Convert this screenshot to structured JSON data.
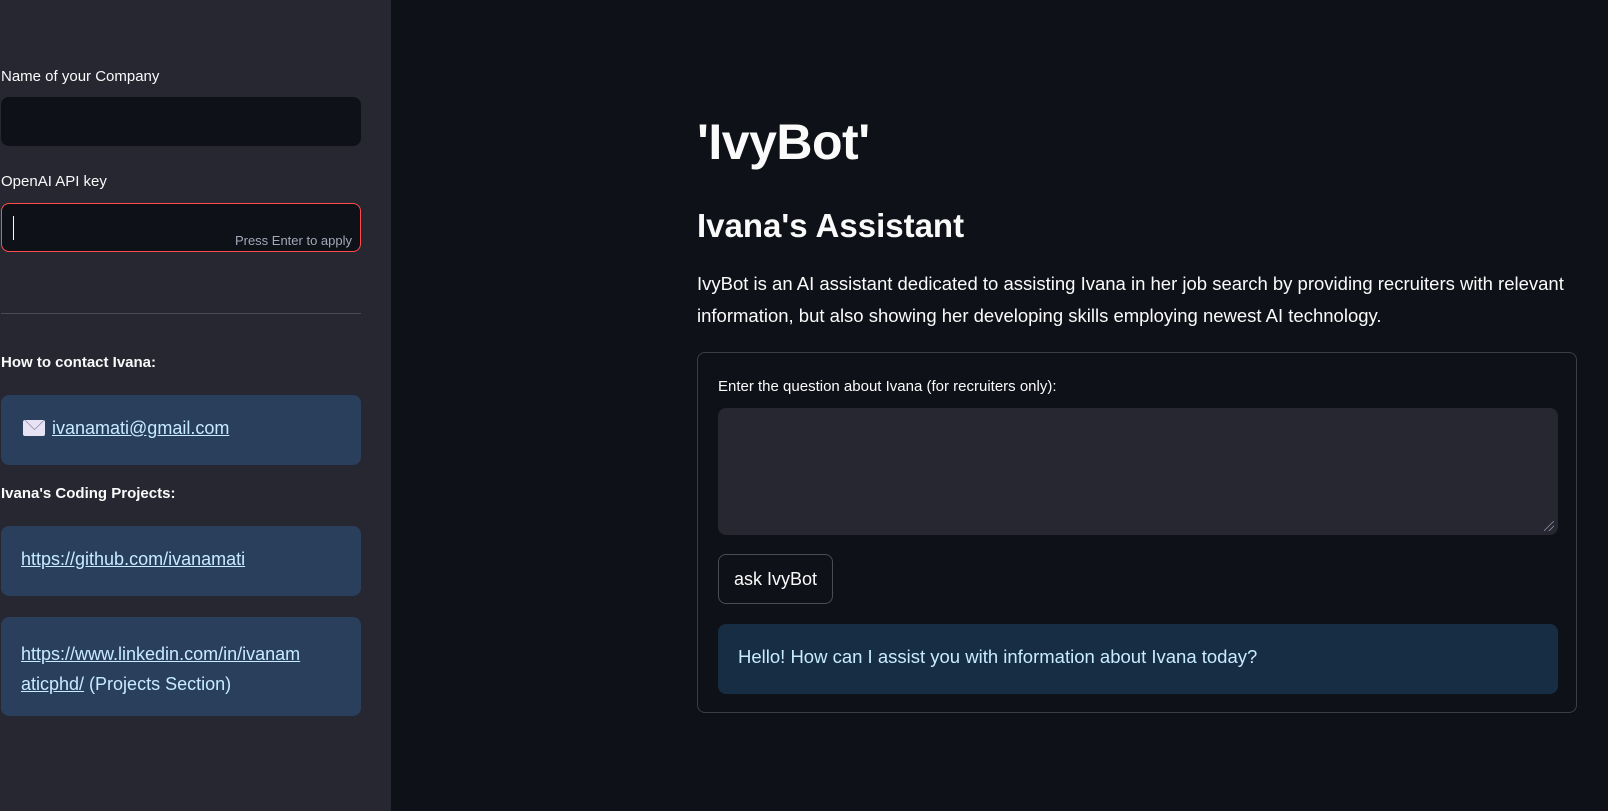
{
  "sidebar": {
    "company_label": "Name of your Company",
    "company_value": "",
    "api_key_label": "OpenAI API key",
    "api_key_value": "",
    "api_key_hint": "Press Enter to apply",
    "contact_heading": "How to contact Ivana:",
    "email": "ivanamati@gmail.com",
    "projects_heading": "Ivana's Coding Projects:",
    "github_link": "https://github.com/ivanamati",
    "linkedin_link_line1": "https://www.linkedin.com/in/ivanam",
    "linkedin_link_line2": "aticphd/",
    "linkedin_suffix": " (Projects Section)"
  },
  "main": {
    "title": "'IvyBot'",
    "subtitle": "Ivana's Assistant",
    "description": "IvyBot is an AI assistant dedicated to assisting Ivana in her job search by providing recruiters with relevant information, but also showing her developing skills employing newest AI technology.",
    "question_label": "Enter the question about Ivana (for recruiters only):",
    "question_value": "",
    "ask_button": "ask IvyBot",
    "reply": "Hello! How can I assist you with information about Ivana today?"
  },
  "icons": {
    "email": "envelope-icon"
  }
}
